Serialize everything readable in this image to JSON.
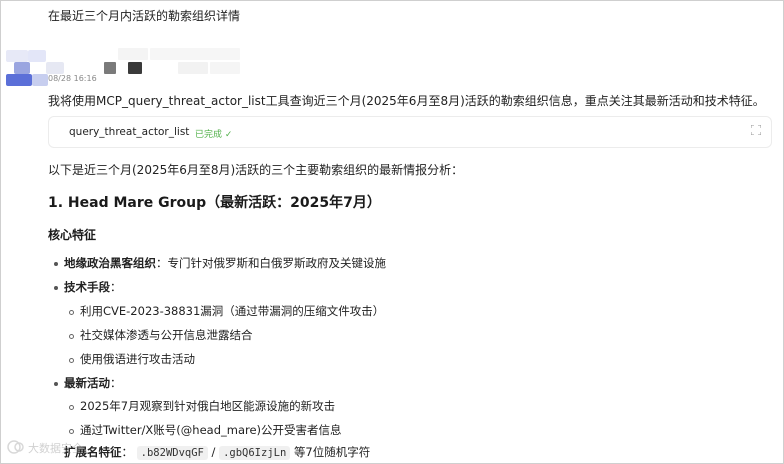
{
  "user_query": "在最近三个月内活跃的勒索组织详情",
  "message": {
    "timestamp": "08/28 16:16",
    "intro": "我将使用MCP_query_threat_actor_list工具查询近三个月(2025年6月至8月)活跃的勒索组织信息，重点关注其最新活动和技术特征。"
  },
  "tool_call": {
    "name": "query_threat_actor_list",
    "status": "已完成 ✓",
    "expand_icon": "expand-icon"
  },
  "summary": "以下是近三个月(2025年6月至8月)活跃的三个主要勒索组织的最新情报分析：",
  "section1": {
    "title": "1. Head Mare Group（最新活跃：2025年7月）",
    "subtitle": "核心特征",
    "item1_label": "地缘政治黑客组织",
    "item1_text": "：专门针对俄罗斯和白俄罗斯政府及关键设施",
    "item2_label": "技术手段",
    "item2_colon": "：",
    "tech": [
      "利用CVE-2023-38831漏洞（通过带漏洞的压缩文件攻击）",
      "社交媒体渗透与公开信息泄露结合",
      "使用俄语进行攻击活动"
    ],
    "item3_label": "最新活动",
    "item3_colon": "：",
    "activities": [
      "2025年7月观察到针对俄白地区能源设施的新攻击",
      "通过Twitter/X账号(@head_mare)公开受害者信息"
    ],
    "ext_label": "扩展名特征",
    "ext_colon": "：",
    "ext_code1": ".b82WDvqGF",
    "ext_sep": "/",
    "ext_code2": ".gbQ6IzjLn",
    "ext_suffix": "等7位随机字符"
  },
  "watermark": "大数据安全"
}
